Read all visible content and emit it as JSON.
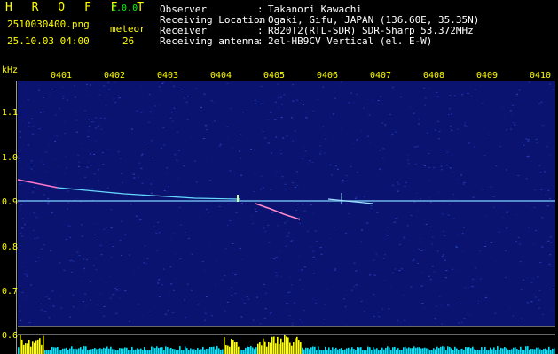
{
  "header": {
    "brand": "H R O F F T",
    "version": "1.0.0",
    "filename": "2510030400.png",
    "datetime": "25.10.03 04:00",
    "meteor_label": "meteor",
    "meteor_count": "26"
  },
  "info": [
    {
      "label": "Observer",
      "value": "Takanori Kawachi"
    },
    {
      "label": "Receiving Location",
      "value": "Ogaki, Gifu, JAPAN (136.60E, 35.35N)"
    },
    {
      "label": "Receiver",
      "value": "R820T2(RTL-SDR) SDR-Sharp 53.372MHz"
    },
    {
      "label": "Receiving antenna",
      "value": "2el-HB9CV Vertical (el. E-W)"
    }
  ],
  "axis": {
    "unit": "kHz",
    "time_ticks": [
      "0401",
      "0402",
      "0403",
      "0404",
      "0405",
      "0406",
      "0407",
      "0408",
      "0409",
      "0410"
    ],
    "freq_ticks": [
      "1.1",
      "1.0",
      "0.9",
      "0.8",
      "0.7",
      "0.6"
    ]
  },
  "colors": {
    "background": "#000000",
    "noise": "#1a2a9c",
    "carrier": "#7fd0ff",
    "label": "#ffff00",
    "bar": "#00e5ff",
    "bar_peak": "#ffff00"
  }
}
